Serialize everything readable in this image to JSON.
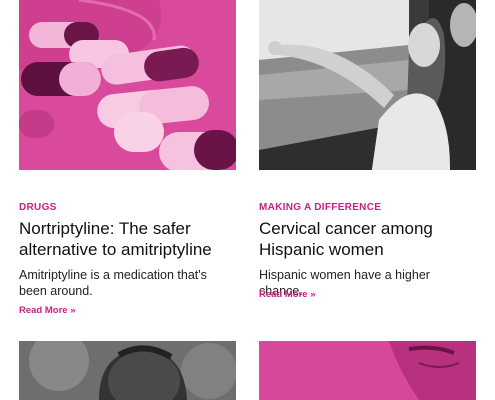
{
  "colors": {
    "accent": "#cc1e84",
    "pink_tint": "#d6489a",
    "text": "#111111"
  },
  "articles": [
    {
      "category": "DRUGS",
      "title": "Nortriptyline: The safer alternative to amitriptyline",
      "description": "Amitriptyline is a medication that's been around.",
      "link": "Read More »",
      "image": "pink-tinted-pill-capsules"
    },
    {
      "category": "MAKING A DIFFERENCE",
      "title": "Cervical cancer among Hispanic women",
      "description": "Hispanic women have a higher chance.",
      "link": "Read More »",
      "image": "grayscale-woman-pointing-out-window"
    },
    {
      "image": "grayscale-smiling-man"
    },
    {
      "image": "pink-tinted-woman-face"
    }
  ]
}
